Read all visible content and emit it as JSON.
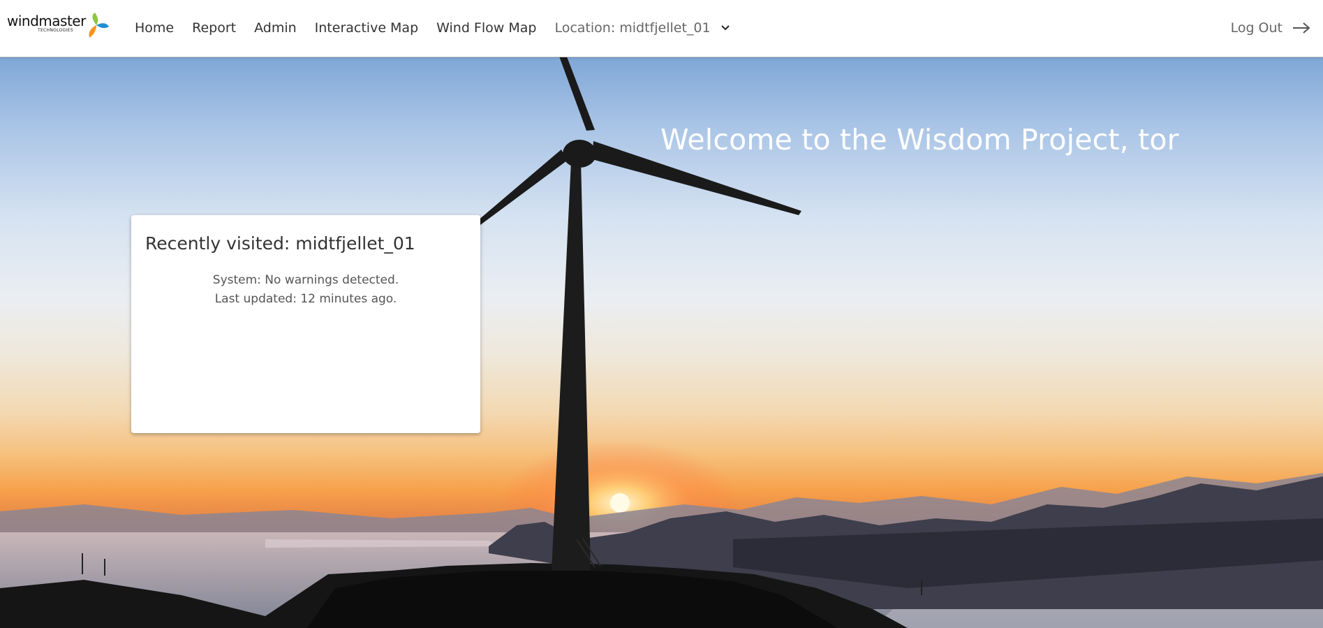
{
  "brand": {
    "name": "windmaster",
    "tagline": "TECHNOLOGIES",
    "colors": {
      "green": "#8dc63f",
      "blue": "#1e8fd6",
      "orange": "#f7941d"
    }
  },
  "nav": {
    "items": [
      {
        "label": "Home"
      },
      {
        "label": "Report"
      },
      {
        "label": "Admin"
      },
      {
        "label": "Interactive Map"
      },
      {
        "label": "Wind Flow Map"
      }
    ],
    "location_label": "Location: midtfjellet_01",
    "location_icon": "chevron-down-icon",
    "logout_label": "Log Out",
    "logout_icon": "arrow-right-icon"
  },
  "hero": {
    "welcome": "Welcome to the Wisdom Project, tor",
    "background": "wind turbine at sunset over mountains and fjord"
  },
  "card": {
    "title": "Recently visited: midtfjellet_01",
    "system_status": "System: No warnings detected.",
    "last_updated": "Last updated: 12 minutes ago."
  }
}
